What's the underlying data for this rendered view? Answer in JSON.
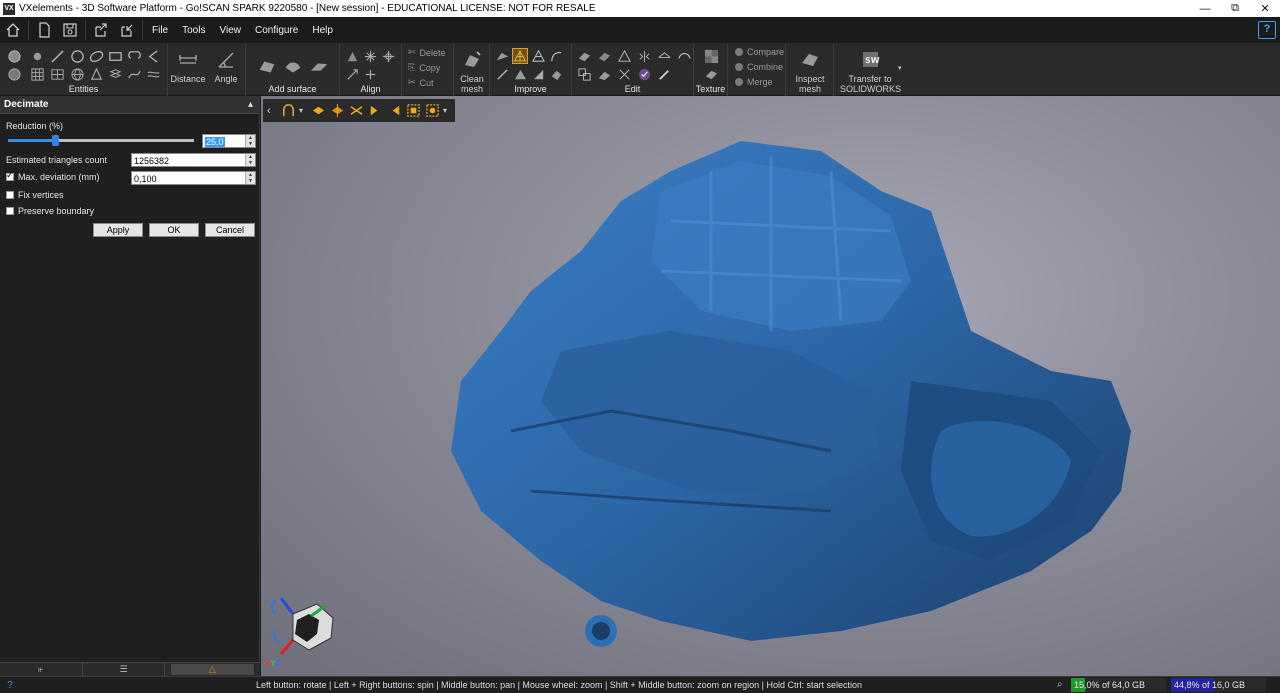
{
  "window": {
    "app_icon": "VX",
    "title": "VXelements - 3D Software Platform - Go!SCAN SPARK 9220580 - [New session] - EDUCATIONAL LICENSE: NOT FOR RESALE",
    "controls": [
      "minimize-icon",
      "restore-icon",
      "close-icon"
    ]
  },
  "menubar": {
    "quick_access": [
      "home-icon",
      "new-document-icon",
      "save-icon",
      "export-icon",
      "import-icon"
    ],
    "items": [
      "File",
      "Tools",
      "View",
      "Configure",
      "Help"
    ],
    "help_icon": "help-question-icon"
  },
  "ribbon": {
    "groups": {
      "entities": "Entities",
      "add_surface": "Add surface",
      "align": "Align",
      "improve": "Improve",
      "edit": "Edit",
      "texture": "Texture"
    },
    "buttons": {
      "distance": "Distance",
      "angle": "Angle",
      "delete": "Delete",
      "copy": "Copy",
      "cut": "Cut",
      "clean_mesh_1": "Clean",
      "clean_mesh_2": "mesh",
      "compare": "Compare",
      "combine": "Combine",
      "merge": "Merge",
      "inspect_mesh_1": "Inspect",
      "inspect_mesh_2": "mesh",
      "transfer_1": "Transfer to",
      "transfer_2": "SOLIDWORKS"
    }
  },
  "panel": {
    "title": "Decimate",
    "reduction_label": "Reduction (%)",
    "reduction_value": "25,0",
    "reduction_fraction": 0.25,
    "triangles_label": "Estimated triangles count",
    "triangles_value": "1256382",
    "max_dev_label": "Max. deviation (mm)",
    "max_dev_value": "0,100",
    "max_dev_checked": true,
    "fix_vertices_label": "Fix vertices",
    "fix_vertices_checked": false,
    "preserve_boundary_label": "Preserve boundary",
    "preserve_boundary_checked": false,
    "apply_label": "Apply",
    "ok_label": "OK",
    "cancel_label": "Cancel",
    "footer_tabs": [
      "tree-icon",
      "list-icon",
      "decimate-icon"
    ]
  },
  "viewport": {
    "toolbar_icons": [
      "selection-shape-icon",
      "select-through-icon",
      "select-visible-icon",
      "select-connected-icon",
      "grow-selection-icon",
      "shrink-selection-icon",
      "invert-selection-icon",
      "select-all-icon"
    ],
    "axis_label": "XYZ",
    "mesh_color": "#2e6fb4",
    "background_color": "#8b8b98"
  },
  "statusbar": {
    "hint": "Left button: rotate | Left + Right buttons: spin | Middle button: pan | Mouse wheel: zoom | Shift + Middle button: zoom on region | Hold Ctrl: start selection",
    "ram": "15,0% of 64,0 GB (RAM)",
    "ram_fraction": 0.15,
    "gpu": "44,8% of 16,0 GB (GPU)",
    "gpu_fraction": 0.448
  }
}
